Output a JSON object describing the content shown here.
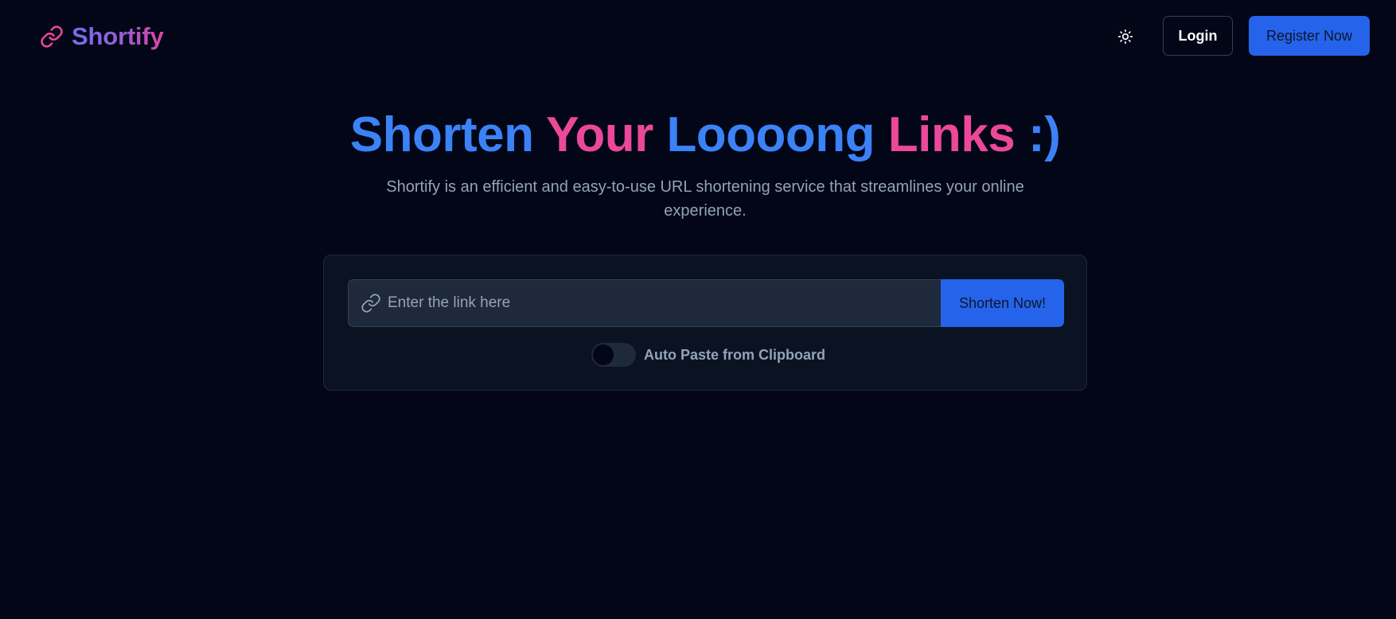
{
  "brand": {
    "name": "Shortify",
    "icon": "link-icon"
  },
  "header": {
    "theme_toggle_icon": "sun-icon",
    "login_label": "Login",
    "register_label": "Register Now"
  },
  "hero": {
    "title_words": [
      "Shorten",
      "Your",
      "Loooong",
      "Links",
      ":)"
    ],
    "subtitle": "Shortify is an efficient and easy-to-use URL shortening service that streamlines your online experience."
  },
  "shortener": {
    "input_placeholder": "Enter the link here",
    "input_value": "",
    "input_icon": "link-icon",
    "submit_label": "Shorten Now!",
    "auto_paste_label": "Auto Paste from Clipboard",
    "auto_paste_enabled": false
  },
  "colors": {
    "background": "#020617",
    "accent_blue": "#3b82f6",
    "accent_pink": "#ec4899",
    "button_blue": "#2563eb"
  }
}
